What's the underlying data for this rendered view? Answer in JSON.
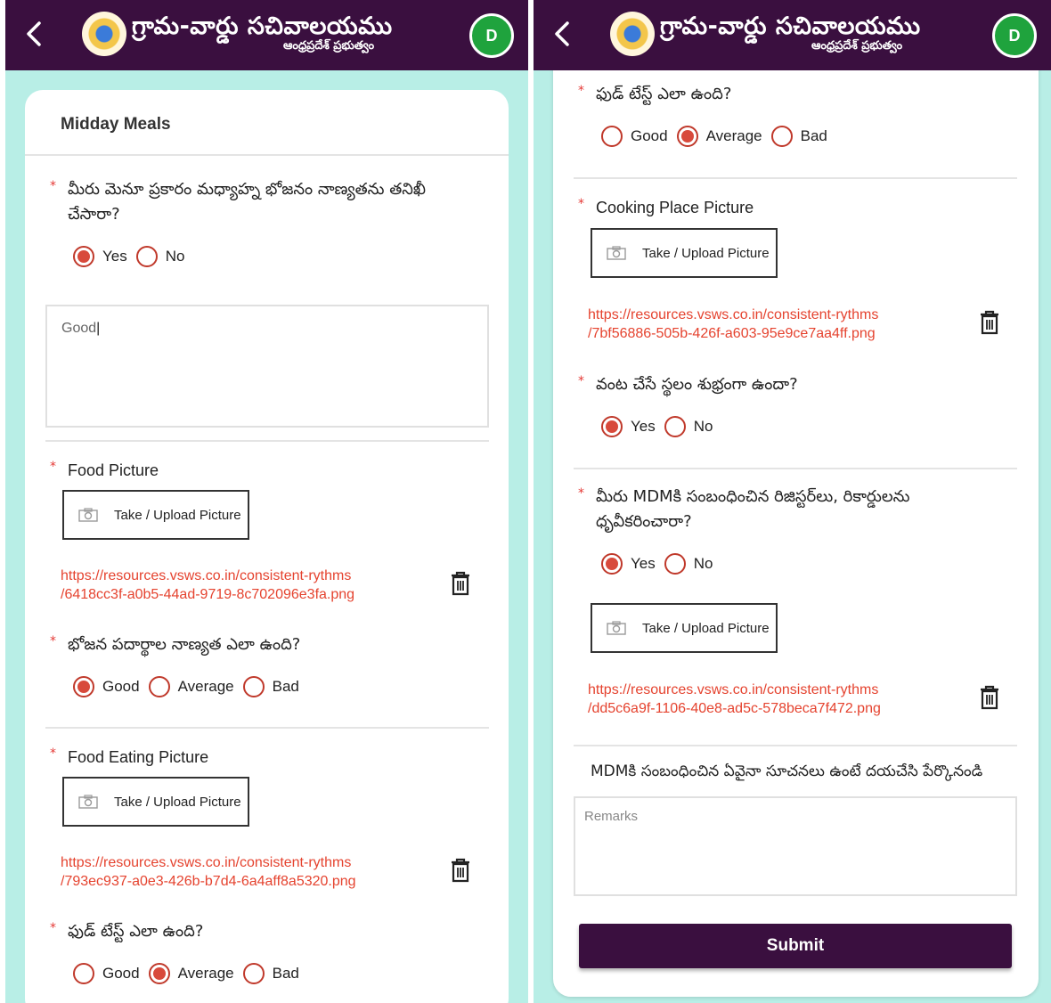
{
  "header": {
    "title": "గ్రామ-వార్డు సచివాలయము",
    "subtitle": "ఆంధ్రప్రదేశ్ ప్రభుత్వం",
    "avatar_letter": "D"
  },
  "colors": {
    "topbar": "#3a0f3f",
    "background": "#b8eee6",
    "accent": "#d84a3c",
    "link": "#e5432f",
    "avatar": "#1fa33d"
  },
  "icons": {
    "back": "chevron-left-icon",
    "camera": "camera-icon",
    "delete": "trash-icon"
  },
  "left": {
    "section_title": "Midday Meals",
    "q1": {
      "text": "మీరు మెనూ ప్రకారం మధ్యాహ్న భోజనం నాణ్యతను తనిఖీ చేసారా?",
      "options": [
        "Yes",
        "No"
      ],
      "selected": "Yes"
    },
    "remarks_value": "Good",
    "food_picture": {
      "label": "Food Picture",
      "button": "Take / Upload Picture",
      "url_line1": "https://resources.vsws.co.in/consistent-rythms",
      "url_line2": "/6418cc3f-a0b5-44ad-9719-8c702096e3fa.png"
    },
    "q2": {
      "text": "భోజన పదార్థాల నాణ్యత ఎలా ఉంది?",
      "options": [
        "Good",
        "Average",
        "Bad"
      ],
      "selected": "Good"
    },
    "food_eating_picture": {
      "label": "Food Eating Picture",
      "button": "Take / Upload Picture",
      "url_line1": "https://resources.vsws.co.in/consistent-rythms",
      "url_line2": "/793ec937-a0e3-426b-b7d4-6a4aff8a5320.png"
    },
    "q3": {
      "text": "ఫుడ్ టేస్ట్ ఎలా ఉంది?",
      "options": [
        "Good",
        "Average",
        "Bad"
      ],
      "selected": "Average"
    }
  },
  "right": {
    "q3": {
      "text": "ఫుడ్ టేస్ట్ ఎలా ఉంది?",
      "options": [
        "Good",
        "Average",
        "Bad"
      ],
      "selected": "Average"
    },
    "cooking_place_picture": {
      "label": "Cooking Place Picture",
      "button": "Take / Upload Picture",
      "url_line1": "https://resources.vsws.co.in/consistent-rythms",
      "url_line2": "/7bf56886-505b-426f-a603-95e9ce7aa4ff.png"
    },
    "q4": {
      "text": "వంట చేసే స్థలం శుభ్రంగా ఉందా?",
      "options": [
        "Yes",
        "No"
      ],
      "selected": "Yes"
    },
    "q5": {
      "text": "మీరు MDMకి సంబంధించిన రిజిస్టర్‌లు, రికార్డులను ధృవీకరించారా?",
      "options": [
        "Yes",
        "No"
      ],
      "selected": "Yes"
    },
    "records_picture": {
      "button": "Take / Upload Picture",
      "url_line1": "https://resources.vsws.co.in/consistent-rythms",
      "url_line2": "/dd5c6a9f-1106-40e8-ad5c-578beca7f472.png"
    },
    "suggestions_label": "MDMకి సంబంధించిన ఏవైనా సూచనలు ఉంటే దయచేసి పేర్కొనండి",
    "remarks_placeholder": "Remarks",
    "submit": "Submit"
  }
}
